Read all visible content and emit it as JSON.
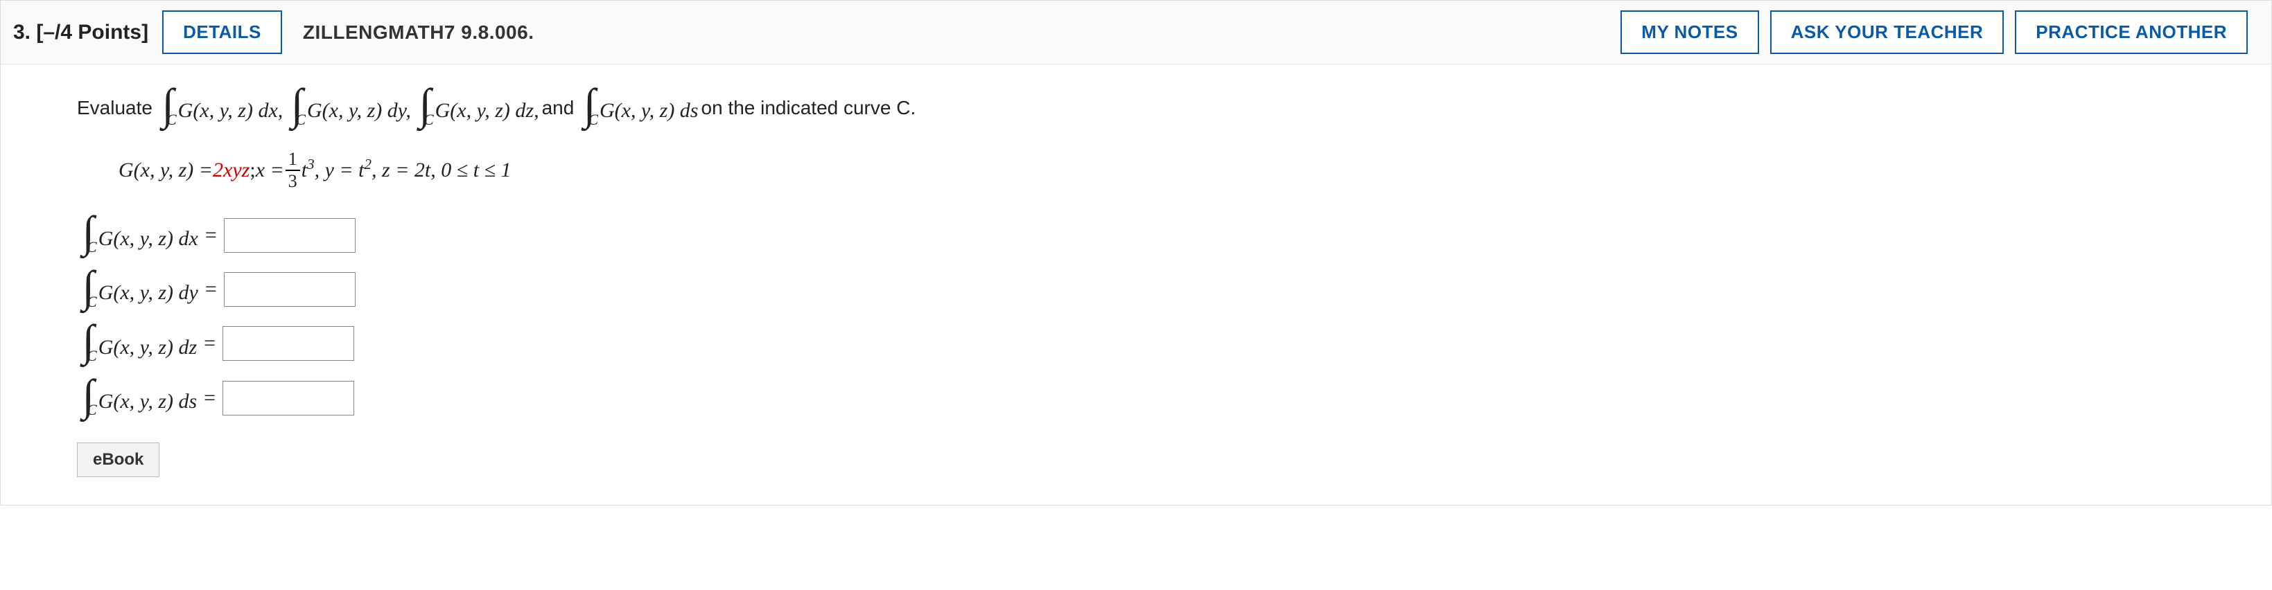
{
  "header": {
    "number_label": "3.",
    "points_label": "[–/4 Points]",
    "details_label": "DETAILS",
    "source_code": "ZILLENGMATH7 9.8.006.",
    "my_notes_label": "MY NOTES",
    "ask_teacher_label": "ASK YOUR TEACHER",
    "practice_label": "PRACTICE ANOTHER"
  },
  "prompt": {
    "evaluate": "Evaluate",
    "int_sub": "C",
    "g1": "G(x, y, z) dx,",
    "g2": "G(x, y, z) dy,",
    "g3": "G(x, y, z) dz,",
    "and": "and",
    "g4": "G(x, y, z) ds",
    "tail": "on the indicated curve C."
  },
  "definition": {
    "lhs": "G(x, y, z) = ",
    "rhs_color": "2xyz",
    "sep": "; ",
    "x_eq": "x = ",
    "frac_num": "1",
    "frac_den": "3",
    "x_term": "t",
    "x_pow": "3",
    "y_part": ", y = t",
    "y_pow": "2",
    "z_part": ", z = 2t, 0 ≤ t ≤ 1"
  },
  "answers": {
    "rows": [
      {
        "var": "dx"
      },
      {
        "var": "dy"
      },
      {
        "var": "dz"
      },
      {
        "var": "ds"
      }
    ],
    "g_label": "G(x, y, z) ",
    "equals": "="
  },
  "ebook_label": "eBook"
}
